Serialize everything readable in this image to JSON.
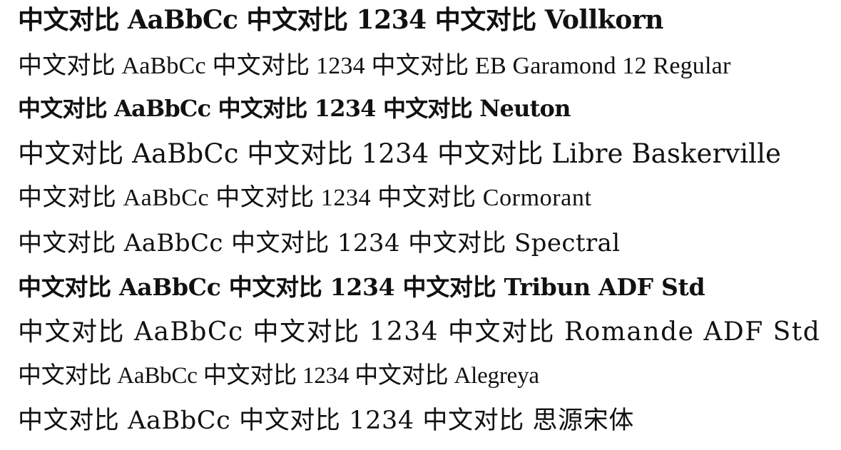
{
  "lines": [
    {
      "sample": "中文对比 AaBbCc 中文对比 1234 中文对比 Vollkorn"
    },
    {
      "sample": "中文对比 AaBbCc 中文对比 1234 中文对比 EB Garamond 12 Regular"
    },
    {
      "sample": "中文对比 AaBbCc 中文对比 1234 中文对比 Neuton"
    },
    {
      "sample": "中文对比 AaBbCc 中文对比 1234 中文对比 Libre Baskerville"
    },
    {
      "sample": "中文对比 AaBbCc 中文对比 1234 中文对比 Cormorant"
    },
    {
      "sample": "中文对比 AaBbCc 中文对比 1234 中文对比 Spectral"
    },
    {
      "sample": "中文对比 AaBbCc 中文对比 1234 中文对比 Tribun ADF Std"
    },
    {
      "sample": "中文对比 AaBbCc 中文对比 1234 中文对比 Romande ADF Std"
    },
    {
      "sample": "中文对比 AaBbCc 中文对比 1234 中文对比 Alegreya"
    },
    {
      "sample": "中文对比 AaBbCc 中文对比 1234 中文对比 思源宋体"
    }
  ]
}
